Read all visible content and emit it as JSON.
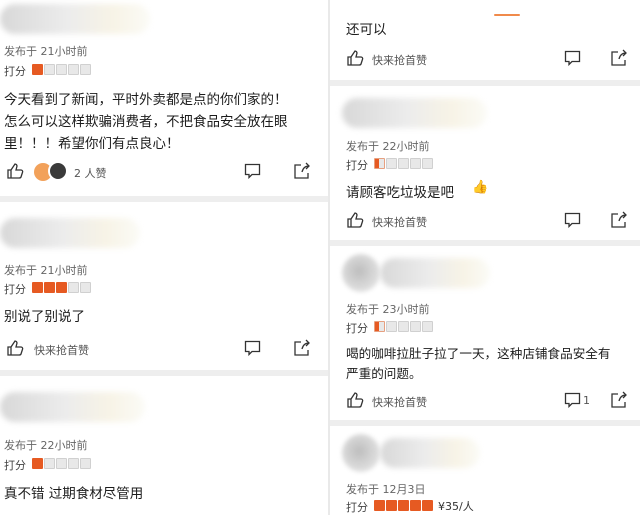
{
  "colors": {
    "accent": "#e65a22",
    "text": "#222222",
    "muted": "#666666",
    "background": "#e9e9e9"
  },
  "left": {
    "comments": [
      {
        "posted": "发布于 21小时前",
        "score_label": "打分",
        "rating": 1,
        "text_lines": [
          "今天看到了新闻，平时外卖都是点的你们家的！",
          "怎么可以这样欺骗消费者，不把食品安全放在眼",
          "里！！！希望你们有点良心！"
        ],
        "like_text": "2 人赞"
      },
      {
        "posted": "发布于 21小时前",
        "score_label": "打分",
        "rating": 3,
        "text_lines": [
          "别说了别说了"
        ],
        "like_text": "快来抢首赞"
      },
      {
        "posted": "发布于 22小时前",
        "score_label": "打分",
        "rating": 1,
        "text_lines": [
          "真不错 过期食材尽管用"
        ],
        "like_text": ""
      }
    ]
  },
  "right": {
    "comments": [
      {
        "text_lines": [
          "还可以"
        ],
        "like_text": "快来抢首赞"
      },
      {
        "posted": "发布于 22小时前",
        "score_label": "打分",
        "rating": 0.5,
        "text_lines": [
          "请顾客吃垃圾是吧"
        ],
        "emoji": "👍",
        "like_text": "快来抢首赞"
      },
      {
        "posted": "发布于 23小时前",
        "score_label": "打分",
        "rating": 0.5,
        "text_lines": [
          "喝的咖啡拉肚子拉了一天，这种店铺食品安全有",
          "严重的问题。"
        ],
        "like_text": "快来抢首赞",
        "comment_count": "1"
      },
      {
        "posted": "发布于 12月3日",
        "score_label": "打分",
        "rating": 5,
        "price": "¥35/人"
      }
    ]
  }
}
